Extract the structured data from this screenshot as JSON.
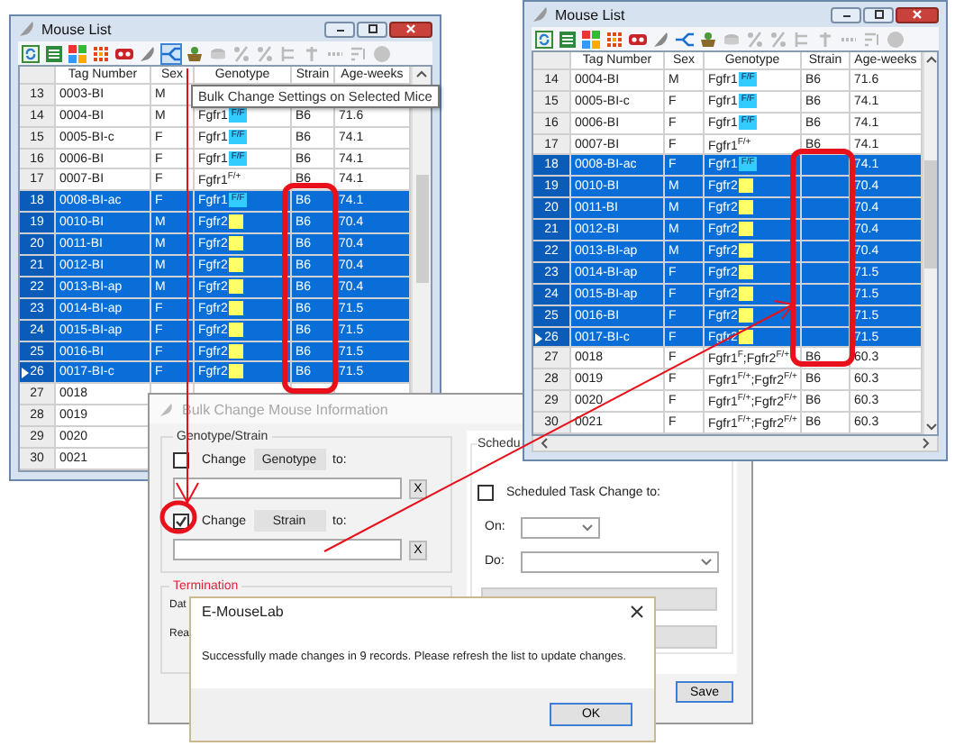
{
  "windows": [
    {
      "title": "Mouse List",
      "tooltip": "Bulk Change Settings on Selected Mice",
      "columns": [
        "Tag Number",
        "Sex",
        "Genotype",
        "Strain",
        "Age-weeks"
      ],
      "rows": [
        {
          "number": "13",
          "tag_number": "0003-BI",
          "sex": "M",
          "selected": false,
          "current": false
        },
        {
          "number": "14",
          "tag_number": "0004-BI",
          "sex": "M",
          "genotype": {
            "text": "Fgfr1",
            "tag": {
              "text": "F/F",
              "color": "#33ccff"
            }
          },
          "strain": "B6",
          "age": "71.6",
          "selected": false,
          "current": false
        },
        {
          "number": "15",
          "tag_number": "0005-BI-c",
          "sex": "F",
          "genotype": {
            "text": "Fgfr1",
            "tag": {
              "text": "F/F",
              "color": "#33ccff"
            }
          },
          "strain": "B6",
          "age": "74.1",
          "selected": false,
          "current": false
        },
        {
          "number": "16",
          "tag_number": "0006-BI",
          "sex": "F",
          "genotype": {
            "text": "Fgfr1",
            "tag": {
              "text": "F/F",
              "color": "#33ccff"
            }
          },
          "strain": "B6",
          "age": "74.1",
          "selected": false,
          "current": false
        },
        {
          "number": "17",
          "tag_number": "0007-BI",
          "sex": "F",
          "genotype": {
            "text": "Fgfr1$^{F/+}$"
          },
          "strain": "B6",
          "age": "74.1",
          "selected": false,
          "current": false
        },
        {
          "number": "18",
          "tag_number": "0008-BI-ac",
          "sex": "F",
          "genotype": {
            "text": "Fgfr1",
            "tag": {
              "text": "F/F",
              "color": "#33ccff"
            }
          },
          "strain": "B6",
          "age": "74.1",
          "selected": true,
          "current": false
        },
        {
          "number": "19",
          "tag_number": "0010-BI",
          "sex": "M",
          "genotype": {
            "text": "Fgfr2",
            "tag": {
              "color": "#ffff66"
            }
          },
          "strain": "B6",
          "age": "70.4",
          "selected": true,
          "current": false
        },
        {
          "number": "20",
          "tag_number": "0011-BI",
          "sex": "M",
          "genotype": {
            "text": "Fgfr2",
            "tag": {
              "color": "#ffff66"
            }
          },
          "strain": "B6",
          "age": "70.4",
          "selected": true,
          "current": false
        },
        {
          "number": "21",
          "tag_number": "0012-BI",
          "sex": "M",
          "genotype": {
            "text": "Fgfr2",
            "tag": {
              "color": "#ffff66"
            }
          },
          "strain": "B6",
          "age": "70.4",
          "selected": true,
          "current": false
        },
        {
          "number": "22",
          "tag_number": "0013-BI-ap",
          "sex": "M",
          "genotype": {
            "text": "Fgfr2",
            "tag": {
              "color": "#ffff66"
            }
          },
          "strain": "B6",
          "age": "70.4",
          "selected": true,
          "current": false
        },
        {
          "number": "23",
          "tag_number": "0014-BI-ap",
          "sex": "F",
          "genotype": {
            "text": "Fgfr2",
            "tag": {
              "color": "#ffff66"
            }
          },
          "strain": "B6",
          "age": "71.5",
          "selected": true,
          "current": false
        },
        {
          "number": "24",
          "tag_number": "0015-BI-ap",
          "sex": "F",
          "genotype": {
            "text": "Fgfr2",
            "tag": {
              "color": "#ffff66"
            }
          },
          "strain": "B6",
          "age": "71.5",
          "selected": true,
          "current": false
        },
        {
          "number": "25",
          "tag_number": "0016-BI",
          "sex": "F",
          "genotype": {
            "text": "Fgfr2",
            "tag": {
              "color": "#ffff66"
            }
          },
          "strain": "B6",
          "age": "71.5",
          "selected": true,
          "current": false
        },
        {
          "number": "26",
          "tag_number": "0017-BI-c",
          "sex": "F",
          "genotype": {
            "text": "Fgfr2",
            "tag": {
              "color": "#ffff66"
            }
          },
          "strain": "B6",
          "age": "71.5",
          "selected": true,
          "current": true
        },
        {
          "number": "27",
          "tag_number": "0018",
          "selected": false,
          "current": false
        },
        {
          "number": "28",
          "tag_number": "0019",
          "selected": false,
          "current": false
        },
        {
          "number": "29",
          "tag_number": "0020",
          "selected": false,
          "current": false
        },
        {
          "number": "30",
          "tag_number": "0021",
          "selected": false,
          "current": false
        }
      ]
    },
    {
      "title": "Mouse List",
      "columns": [
        "Tag Number",
        "Sex",
        "Genotype",
        "Strain",
        "Age-weeks"
      ],
      "rows": [
        {
          "number": "14",
          "tag_number": "0004-BI",
          "sex": "M",
          "genotype": {
            "text": "Fgfr1",
            "tag": {
              "text": "F/F",
              "color": "#33ccff"
            }
          },
          "strain": "B6",
          "age": "71.6",
          "selected": false,
          "current": false
        },
        {
          "number": "15",
          "tag_number": "0005-BI-c",
          "sex": "F",
          "genotype": {
            "text": "Fgfr1",
            "tag": {
              "text": "F/F",
              "color": "#33ccff"
            }
          },
          "strain": "B6",
          "age": "74.1",
          "selected": false,
          "current": false
        },
        {
          "number": "16",
          "tag_number": "0006-BI",
          "sex": "F",
          "genotype": {
            "text": "Fgfr1",
            "tag": {
              "text": "F/F",
              "color": "#33ccff"
            }
          },
          "strain": "B6",
          "age": "74.1",
          "selected": false,
          "current": false
        },
        {
          "number": "17",
          "tag_number": "0007-BI",
          "sex": "F",
          "genotype": {
            "text": "Fgfr1$^{F/+}$"
          },
          "strain": "B6",
          "age": "74.1",
          "selected": false,
          "current": false
        },
        {
          "number": "18",
          "tag_number": "0008-BI-ac",
          "sex": "F",
          "genotype": {
            "text": "Fgfr1",
            "tag": {
              "text": "F/F",
              "color": "#33ccff"
            }
          },
          "age": "74.1",
          "selected": true,
          "current": false
        },
        {
          "number": "19",
          "tag_number": "0010-BI",
          "sex": "M",
          "genotype": {
            "text": "Fgfr2",
            "tag": {
              "color": "#ffff66"
            }
          },
          "age": "70.4",
          "selected": true,
          "current": false
        },
        {
          "number": "20",
          "tag_number": "0011-BI",
          "sex": "M",
          "genotype": {
            "text": "Fgfr2",
            "tag": {
              "color": "#ffff66"
            }
          },
          "age": "70.4",
          "selected": true,
          "current": false
        },
        {
          "number": "21",
          "tag_number": "0012-BI",
          "sex": "M",
          "genotype": {
            "text": "Fgfr2",
            "tag": {
              "color": "#ffff66"
            }
          },
          "age": "70.4",
          "selected": true,
          "current": false
        },
        {
          "number": "22",
          "tag_number": "0013-BI-ap",
          "sex": "M",
          "genotype": {
            "text": "Fgfr2",
            "tag": {
              "color": "#ffff66"
            }
          },
          "age": "70.4",
          "selected": true,
          "current": false
        },
        {
          "number": "23",
          "tag_number": "0014-BI-ap",
          "sex": "F",
          "genotype": {
            "text": "Fgfr2",
            "tag": {
              "color": "#ffff66"
            }
          },
          "age": "71.5",
          "selected": true,
          "current": false
        },
        {
          "number": "24",
          "tag_number": "0015-BI-ap",
          "sex": "F",
          "genotype": {
            "text": "Fgfr2",
            "tag": {
              "color": "#ffff66"
            }
          },
          "age": "71.5",
          "selected": true,
          "current": false
        },
        {
          "number": "25",
          "tag_number": "0016-BI",
          "sex": "F",
          "genotype": {
            "text": "Fgfr2",
            "tag": {
              "color": "#ffff66"
            }
          },
          "age": "71.5",
          "selected": true,
          "current": false
        },
        {
          "number": "26",
          "tag_number": "0017-BI-c",
          "sex": "F",
          "genotype": {
            "text": "Fgfr2",
            "tag": {
              "color": "#ffff66"
            }
          },
          "age": "71.5",
          "selected": true,
          "current": true
        },
        {
          "number": "27",
          "tag_number": "0018",
          "sex": "F",
          "genotype": {
            "text": "Fgfr1$^{F}$;Fgfr2$^{F/+}$"
          },
          "strain": "B6",
          "age": "60.3",
          "selected": false,
          "current": false
        },
        {
          "number": "28",
          "tag_number": "0019",
          "sex": "F",
          "genotype": {
            "text": "Fgfr1$^{F/+}$;Fgfr2$^{F/+}$"
          },
          "strain": "B6",
          "age": "60.3",
          "selected": false,
          "current": false
        },
        {
          "number": "29",
          "tag_number": "0020",
          "sex": "F",
          "genotype": {
            "text": "Fgfr1$^{F/+}$;Fgfr2$^{F/+}$"
          },
          "strain": "B6",
          "age": "60.3",
          "selected": false,
          "current": false
        },
        {
          "number": "30",
          "tag_number": "0021",
          "sex": "F",
          "genotype": {
            "text": "Fgfr1$^{F/+}$;Fgfr2$^{F/+}$"
          },
          "strain": "B6",
          "age": "60.3",
          "selected": false,
          "current": false
        }
      ]
    }
  ],
  "dialog": {
    "title": "Bulk Change Mouse Information",
    "genotype_strain": {
      "label": "Genotype/Strain",
      "rows": [
        {
          "checked": false,
          "check_label": "Change",
          "button": "Genotype",
          "to": "to:",
          "clear": "X"
        },
        {
          "checked": true,
          "check_label": "Change",
          "button": "Strain",
          "to": "to:",
          "clear": "X"
        }
      ]
    },
    "termination": {
      "label": "Termination",
      "fields": [
        "Dat",
        "Rea"
      ]
    },
    "schedule": {
      "label": "Schedu",
      "checked": false,
      "check_label": "Scheduled Task Change to:",
      "on_label": "On:",
      "do_label": "Do:"
    },
    "save": "Save"
  },
  "message_box": {
    "title": "E-MouseLab",
    "message": "Successfully made changes in 9 records. Please refresh the list to update changes.",
    "ok": "OK"
  }
}
